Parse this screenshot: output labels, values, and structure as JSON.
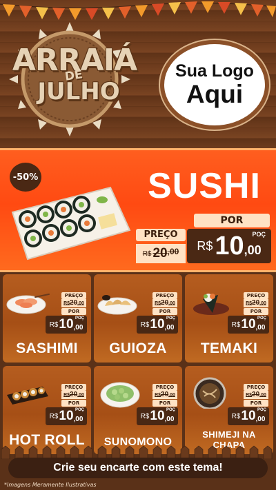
{
  "header": {
    "title_top": "ARRAIÁ",
    "title_mid": "DE",
    "title_bottom": "JULHO",
    "logo_line1": "Sua Logo",
    "logo_line2": "Aqui"
  },
  "hero": {
    "discount_badge": "-50%",
    "product": "SUSHI",
    "preco_label": "PREÇO",
    "por_label": "POR",
    "old_currency": "R$",
    "old_value": "20",
    "old_cents": ",00",
    "new_currency": "R$",
    "new_value": "10",
    "new_cents": ",00",
    "poc": "POÇ"
  },
  "cards": [
    {
      "name": "SASHIMI",
      "preco_label": "PREÇO",
      "old_currency": "R$",
      "old_value": "20",
      "old_cents": ",00",
      "por_label": "POR",
      "new_currency": "R$",
      "new_value": "10",
      "new_cents": ",00",
      "poc": "POÇ"
    },
    {
      "name": "GUIOZA",
      "preco_label": "PREÇO",
      "old_currency": "R$",
      "old_value": "20",
      "old_cents": ",00",
      "por_label": "POR",
      "new_currency": "R$",
      "new_value": "10",
      "new_cents": ",00",
      "poc": "POÇ"
    },
    {
      "name": "TEMAKI",
      "preco_label": "PREÇO",
      "old_currency": "R$",
      "old_value": "20",
      "old_cents": ",00",
      "por_label": "POR",
      "new_currency": "R$",
      "new_value": "10",
      "new_cents": ",00",
      "poc": "POÇ"
    },
    {
      "name": "HOT ROLL",
      "preco_label": "PREÇO",
      "old_currency": "R$",
      "old_value": "20",
      "old_cents": ",00",
      "por_label": "POR",
      "new_currency": "R$",
      "new_value": "10",
      "new_cents": ",00",
      "poc": "POÇ"
    },
    {
      "name": "SUNOMONO",
      "preco_label": "PREÇO",
      "old_currency": "R$",
      "old_value": "20",
      "old_cents": ",00",
      "por_label": "POR",
      "new_currency": "R$",
      "new_value": "10",
      "new_cents": ",00",
      "poc": "POÇ"
    },
    {
      "name_line1": "SHIMEJI NA",
      "name_line2": "CHAPA",
      "preco_label": "PREÇO",
      "old_currency": "R$",
      "old_value": "20",
      "old_cents": ",00",
      "por_label": "POR",
      "new_currency": "R$",
      "new_value": "10",
      "new_cents": ",00",
      "poc": "POÇ"
    }
  ],
  "footer": {
    "cta": "Crie seu encarte com este tema!",
    "disclaimer": "*Imagens Meramente Ilustrativas"
  },
  "colors": {
    "hero_orange": "#ff4a12",
    "card_brown": "#a64f16",
    "price_dark": "#4a2814",
    "price_light": "#ffe2c4"
  },
  "icons": [
    "bunting-flags-icon",
    "sushi-plate-icon",
    "sashimi-icon",
    "guioza-icon",
    "temaki-icon",
    "hot-roll-icon",
    "sunomono-icon",
    "shimeji-icon",
    "fence-icon"
  ]
}
